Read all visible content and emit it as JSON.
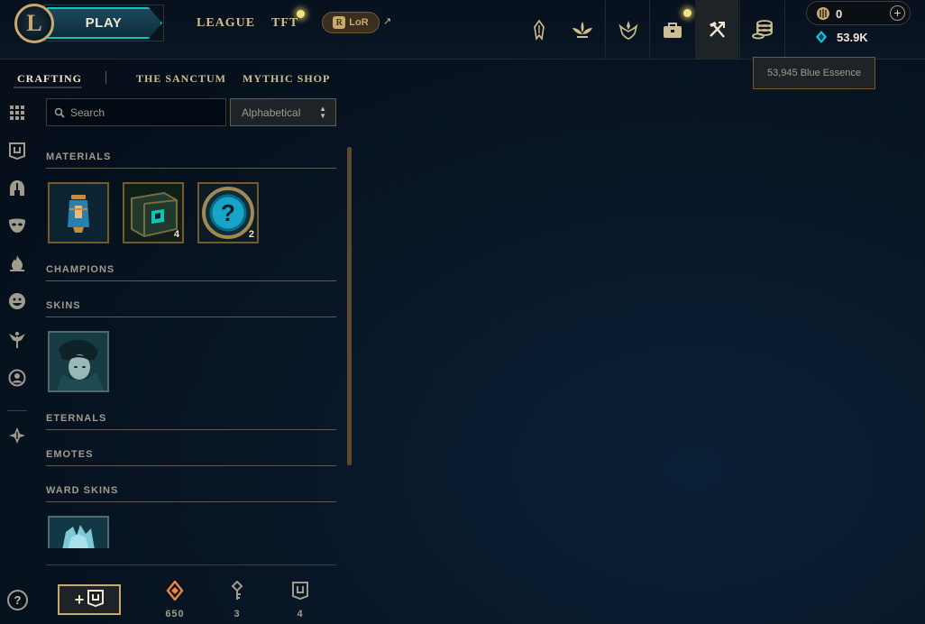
{
  "topbar": {
    "play_label": "PLAY",
    "nav": [
      {
        "label": "LEAGUE"
      },
      {
        "label": "TFT"
      }
    ],
    "lor_label": "LoR",
    "ext_arrow": "↗",
    "icons": [
      "champions-icon",
      "spells-icon",
      "tft-icon",
      "loot-bag-icon",
      "crafting-icon",
      "store-coins-icon"
    ],
    "rp_value": "0",
    "be_value": "53.9K",
    "tooltip": "53,945 Blue Essence"
  },
  "subnav": {
    "items": [
      {
        "label": "CRAFTING",
        "active": true
      },
      {
        "label": "THE SANCTUM"
      },
      {
        "label": "MYTHIC SHOP"
      }
    ]
  },
  "rail": {
    "icons": [
      "grid-icon",
      "chest-icon",
      "helmet-icon",
      "mask-icon",
      "flame-icon",
      "emote-face-icon",
      "ward-icon",
      "profile-icon",
      "eternals-icon"
    ],
    "help_label": "?"
  },
  "search": {
    "placeholder": "Search",
    "value": ""
  },
  "sort": {
    "selected": "Alphabetical"
  },
  "sections": {
    "materials": {
      "title": "MATERIALS",
      "items": [
        {
          "name": "orb-item",
          "count": ""
        },
        {
          "name": "hextech-chest-item",
          "count": "4"
        },
        {
          "name": "mystery-item",
          "count": "2"
        }
      ]
    },
    "champions": {
      "title": "CHAMPIONS"
    },
    "skins": {
      "title": "SKINS"
    },
    "eternals": {
      "title": "ETERNALS"
    },
    "emotes": {
      "title": "EMOTES"
    },
    "ward_skins": {
      "title": "WARD SKINS"
    }
  },
  "footer": {
    "add_label": "+",
    "orange_essence": "650",
    "keys": "3",
    "chests": "4"
  },
  "colors": {
    "gold": "#c8aa6e",
    "teal": "#0ac8b9",
    "orange_essence": "#f0843c",
    "blue_essence": "#0ac8e0"
  }
}
